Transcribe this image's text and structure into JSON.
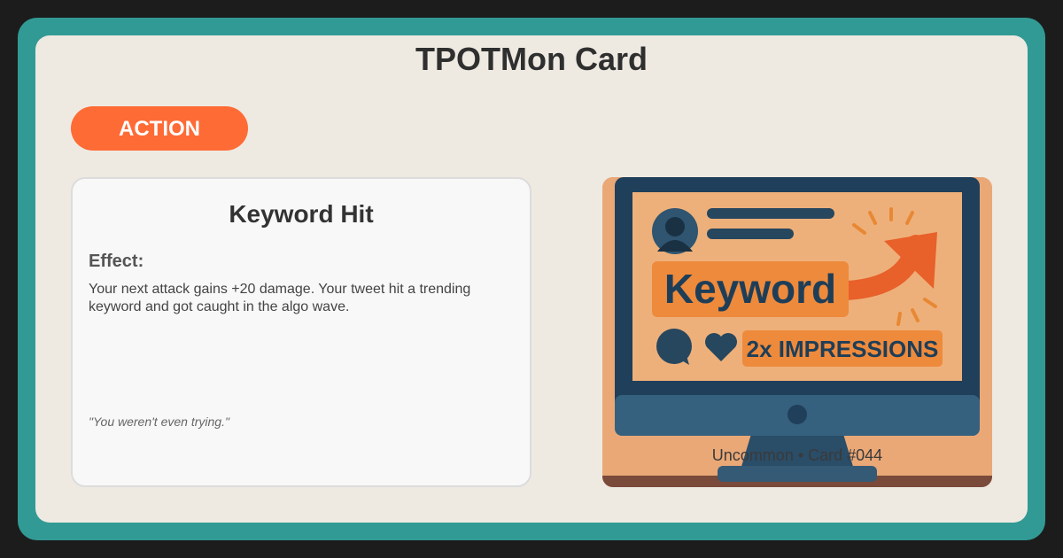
{
  "header": {
    "title": "TPOTMon Card"
  },
  "badge": {
    "label": "ACTION"
  },
  "card": {
    "name": "Keyword Hit",
    "effect_label": "Effect:",
    "effect_text": "Your next attack gains +20 damage. Your tweet hit a trending keyword and got caught in the algo wave.",
    "flavor_text": "\"You weren't even trying.\""
  },
  "art": {
    "keyword_text": "Keyword",
    "impressions_text": "2x IMPRESSIONS",
    "rarity_text": "Uncommon • Card #044"
  },
  "colors": {
    "frame": "#329a94",
    "panel": "#eeeae2",
    "badge": "#ff6b35",
    "art_orange": "#ee8a3c",
    "art_navy": "#1e3e58"
  }
}
